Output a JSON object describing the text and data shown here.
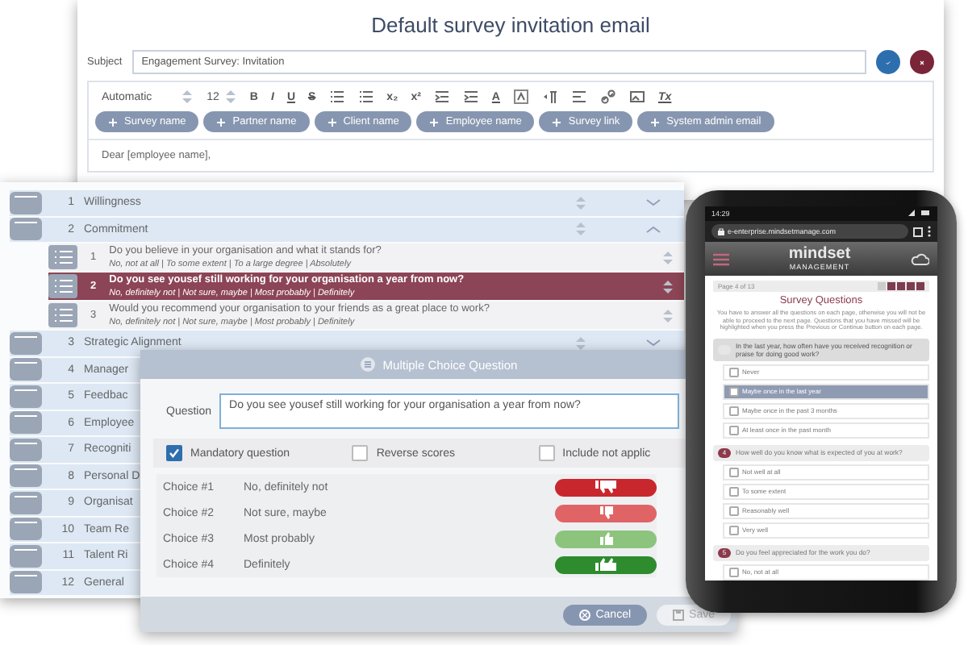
{
  "email_editor": {
    "title": "Default survey invitation email",
    "subject_label": "Subject",
    "subject_value": "Engagement Survey: Invitation",
    "toolbar": {
      "font": "Automatic",
      "size": "12",
      "format_marks": [
        "B",
        "I",
        "U",
        "S"
      ],
      "script_marks": [
        "x₂",
        "x²"
      ],
      "color_mark": "A",
      "clear_mark": "Tx"
    },
    "insert_buttons": [
      "Survey name",
      "Partner name",
      "Client name",
      "Employee name",
      "Survey link",
      "System admin email"
    ],
    "body": "Dear [employee name],"
  },
  "question_list": {
    "sections": [
      {
        "number": "1",
        "name": "Willingness",
        "expanded": false
      },
      {
        "number": "2",
        "name": "Commitment",
        "expanded": true,
        "children": [
          {
            "number": "1",
            "question": "Do you believe in your organisation and what it stands for?",
            "answers": "No, not at all | To some extent | To a large degree | Absolutely",
            "selected": false
          },
          {
            "number": "2",
            "question": "Do you see yousef still working for your organisation a year from now?",
            "answers": "No, definitely not | Not sure, maybe | Most probably | Definitely",
            "selected": true
          },
          {
            "number": "3",
            "question": "Would you recommend your organisation to your friends as a great place to work?",
            "answers": "No, definitely not | Not sure, maybe | Most probably | Definitely",
            "selected": false
          }
        ]
      },
      {
        "number": "3",
        "name": "Strategic Alignment",
        "expanded": false
      },
      {
        "number": "4",
        "name": "Manager"
      },
      {
        "number": "5",
        "name": "Feedbac"
      },
      {
        "number": "6",
        "name": "Employee"
      },
      {
        "number": "7",
        "name": "Recogniti"
      },
      {
        "number": "8",
        "name": "Personal D"
      },
      {
        "number": "9",
        "name": "Organisat"
      },
      {
        "number": "10",
        "name": "Team Re"
      },
      {
        "number": "11",
        "name": "Talent Ri"
      },
      {
        "number": "12",
        "name": "General"
      }
    ]
  },
  "dialog": {
    "title": "Multiple Choice Question",
    "question_label": "Question",
    "question_value": "Do you see yousef still working for your organisation a year from now?",
    "options": [
      {
        "label": "Mandatory question",
        "checked": true
      },
      {
        "label": "Reverse scores",
        "checked": false
      },
      {
        "label": "Include not applic",
        "checked": false
      }
    ],
    "choices": [
      {
        "label": "Choice #1",
        "text": "No, definitely not",
        "kind": "down2",
        "color": "#c8282d"
      },
      {
        "label": "Choice #2",
        "text": "Not sure, maybe",
        "kind": "down",
        "color": "#e06466"
      },
      {
        "label": "Choice #3",
        "text": "Most probably",
        "kind": "up",
        "color": "#8cc47e"
      },
      {
        "label": "Choice #4",
        "text": "Definitely",
        "kind": "up2",
        "color": "#2e8b2e"
      }
    ],
    "buttons": [
      {
        "label": "Cancel",
        "kind": "cancel"
      },
      {
        "label": "Save",
        "kind": "save"
      }
    ]
  },
  "phone": {
    "time": "14:29",
    "url": "e-enterprise.mindsetmanage.com",
    "logo": "mindset",
    "logo_sub": "MANAGEMENT",
    "page": "Page 4 of 13",
    "heading": "Survey Questions",
    "intro": "You have to answer all the questions on each page, otherwise you will not be able to proceed to the next page. Questions that you have missed will be highlighted when you press the Previous or Continue button on each page.",
    "questions": [
      {
        "text": "In the last year, how often have you received recognition or praise for doing good work?",
        "options": [
          {
            "label": "Never",
            "selected": false
          },
          {
            "label": "Maybe once in the last year",
            "selected": true
          },
          {
            "label": "Maybe once in the past 3 months",
            "selected": false
          },
          {
            "label": "At least once in the past month",
            "selected": false
          }
        ]
      },
      {
        "number": "4",
        "text": "How well do you know what is expected of you at work?",
        "options": [
          {
            "label": "Not well at all",
            "selected": false
          },
          {
            "label": "To some extent",
            "selected": false
          },
          {
            "label": "Reasonably well",
            "selected": false
          },
          {
            "label": "Very well",
            "selected": false
          }
        ]
      },
      {
        "number": "5",
        "text": "Do you feel appreciated for the work you do?",
        "options": [
          {
            "label": "No, not at all",
            "selected": false
          }
        ]
      }
    ]
  }
}
